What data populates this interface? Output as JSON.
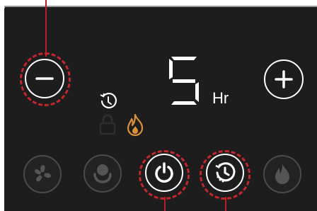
{
  "display": {
    "hours_value": "5",
    "unit_label": "Hr"
  },
  "controls": {
    "minus": {
      "icon": "minus-icon"
    },
    "plus": {
      "icon": "plus-icon"
    },
    "fan": {
      "icon": "fan-icon",
      "state": "inactive"
    },
    "comfort": {
      "icon": "person-heat-icon",
      "state": "inactive"
    },
    "power": {
      "icon": "power-icon",
      "state": "active"
    },
    "timer": {
      "icon": "timer-icon",
      "state": "active"
    },
    "flame": {
      "icon": "flame-icon",
      "state": "inactive"
    }
  },
  "indicators": {
    "timer": {
      "icon": "clock-icon",
      "state": "on"
    },
    "lock": {
      "icon": "lock-icon",
      "state": "off"
    },
    "heat": {
      "icon": "flame-icon",
      "state": "on"
    }
  },
  "colors": {
    "panel": "#1d1d1e",
    "active_white": "#ffffff",
    "inactive_gray": "#4a4a4a",
    "highlight_red": "#c1272d",
    "heat_orange": "#d9913a"
  }
}
